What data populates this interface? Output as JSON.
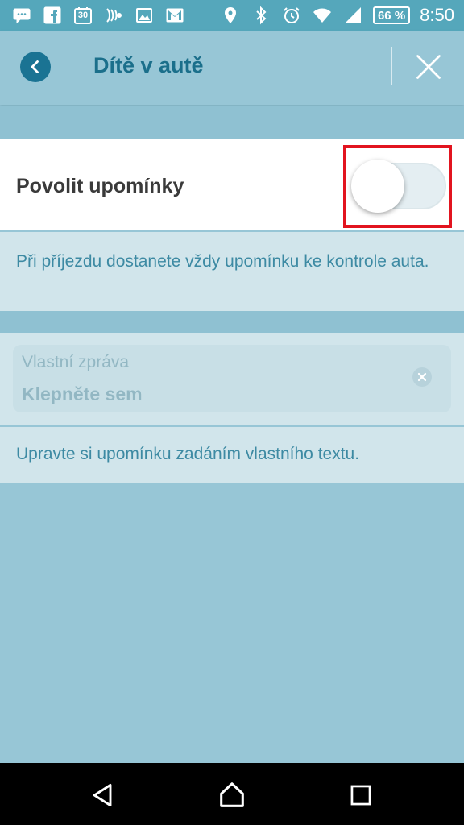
{
  "status_bar": {
    "icons_left": [
      "chat-icon",
      "facebook-icon",
      "calendar-icon",
      "nfc-icon",
      "gallery-icon",
      "gmail-icon"
    ],
    "calendar_day": "30",
    "icons_right": [
      "location-icon",
      "bluetooth-icon",
      "alarm-icon",
      "wifi-icon",
      "signal-icon"
    ],
    "battery": "66 %",
    "time": "8:50"
  },
  "header": {
    "title": "Dítě v autě",
    "back_icon": "chevron-left-icon",
    "close_icon": "close-icon"
  },
  "reminder_toggle": {
    "label": "Povolit upomínky",
    "enabled": false,
    "hint": "Při příjezdu dostanete vždy upomínku ke kontrole auta."
  },
  "custom_message": {
    "label": "Vlastní zpráva",
    "placeholder": "Klepněte sem",
    "hint": "Upravte si upomínku zadáním vlastního textu."
  },
  "nav_bar": {
    "buttons": [
      "back-triangle-icon",
      "home-icon",
      "recents-icon"
    ]
  },
  "colors": {
    "status_bar": "#55a7bb",
    "background": "#97c6d6",
    "title": "#1b6f8b",
    "highlight": "#e2141f"
  }
}
